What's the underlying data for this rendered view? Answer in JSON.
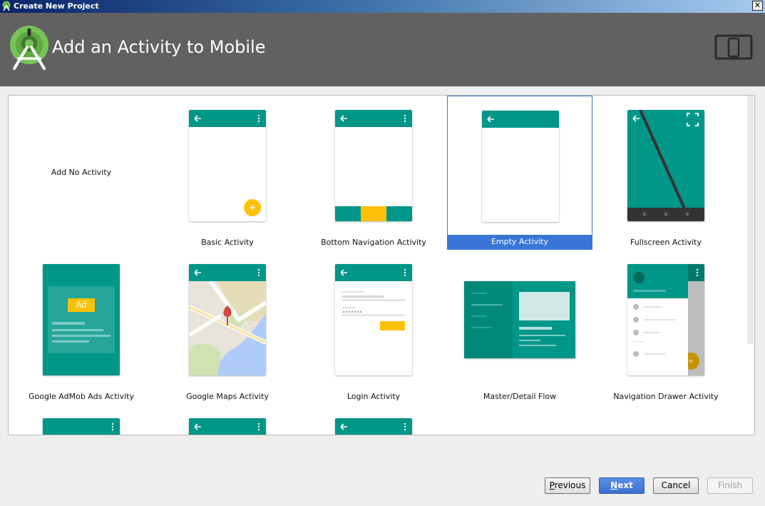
{
  "window": {
    "title": "Create New Project",
    "close_glyph": "✕"
  },
  "header": {
    "title": "Add an Activity to Mobile",
    "logo_icon": "android-studio-logo-icon",
    "device_icon": "phone-tablet-icon"
  },
  "colors": {
    "teal": "#009688",
    "teal_dark": "#00796b",
    "amber": "#ffc107",
    "selection": "#3875d7",
    "header_bg": "#616161"
  },
  "templates": [
    {
      "label": "Add No Activity"
    },
    {
      "label": "Basic Activity"
    },
    {
      "label": "Bottom Navigation Activity"
    },
    {
      "label": "Empty Activity",
      "selected": true
    },
    {
      "label": "Fullscreen Activity"
    },
    {
      "label": "Google AdMob Ads Activity",
      "ad_badge": "Ad"
    },
    {
      "label": "Google Maps Activity"
    },
    {
      "label": "Login Activity"
    },
    {
      "label": "Master/Detail Flow"
    },
    {
      "label": "Navigation Drawer Activity"
    }
  ],
  "buttons": {
    "previous": {
      "label": "Previous",
      "mnemonic": "P",
      "rest": "revious"
    },
    "next": {
      "label": "Next",
      "mnemonic": "N",
      "rest": "ext"
    },
    "cancel": {
      "label": "Cancel"
    },
    "finish": {
      "label": "Finish"
    }
  }
}
